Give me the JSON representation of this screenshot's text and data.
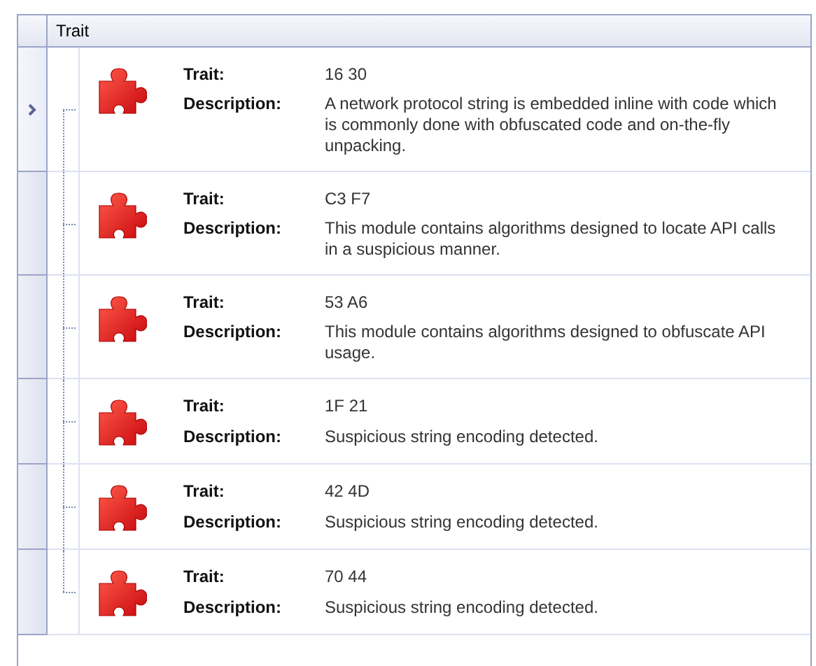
{
  "header": {
    "column": "Trait"
  },
  "rows": [
    {
      "trait_label": "Trait:",
      "trait": "16 30",
      "description_label": "Description:",
      "description": "A network protocol string is embedded inline with code which is commonly done with obfuscated code and on-the-fly unpacking.",
      "selected": true
    },
    {
      "trait_label": "Trait:",
      "trait": "C3 F7",
      "description_label": "Description:",
      "description": "This module contains algorithms designed to locate API calls in a suspicious manner.",
      "selected": false
    },
    {
      "trait_label": "Trait:",
      "trait": "53 A6",
      "description_label": "Description:",
      "description": "This module contains algorithms designed to obfuscate API usage.",
      "selected": false
    },
    {
      "trait_label": "Trait:",
      "trait": "1F 21",
      "description_label": "Description:",
      "description": "Suspicious string encoding detected.",
      "selected": false
    },
    {
      "trait_label": "Trait:",
      "trait": "42 4D",
      "description_label": "Description:",
      "description": "Suspicious string encoding detected.",
      "selected": false
    },
    {
      "trait_label": "Trait:",
      "trait": "70 44",
      "description_label": "Description:",
      "description": "Suspicious string encoding detected.",
      "selected": false
    }
  ]
}
